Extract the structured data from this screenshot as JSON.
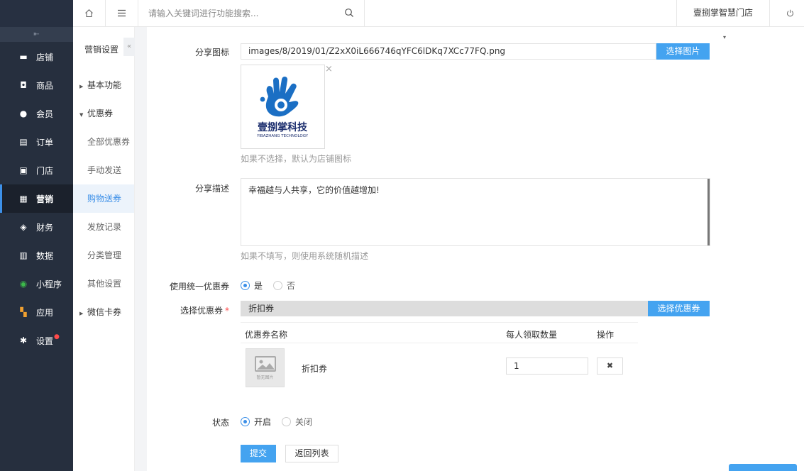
{
  "topbar": {
    "search_placeholder": "请输入关键词进行功能搜索...",
    "store_name": "壹捌掌智慧门店"
  },
  "sidebar": {
    "items": [
      {
        "label": "店铺",
        "icon": "store-icon"
      },
      {
        "label": "商品",
        "icon": "goods-icon"
      },
      {
        "label": "会员",
        "icon": "user-icon"
      },
      {
        "label": "订单",
        "icon": "order-icon"
      },
      {
        "label": "门店",
        "icon": "shop-icon"
      },
      {
        "label": "营销",
        "icon": "gift-icon"
      },
      {
        "label": "财务",
        "icon": "money-icon"
      },
      {
        "label": "数据",
        "icon": "chart-icon"
      },
      {
        "label": "小程序",
        "icon": "miniprogram-icon"
      },
      {
        "label": "应用",
        "icon": "apps-icon"
      },
      {
        "label": "设置",
        "icon": "gear-icon"
      }
    ],
    "active_color": "#3d90e8"
  },
  "subnav": {
    "title": "营销设置",
    "items": [
      {
        "label": "基本功能"
      },
      {
        "label": "优惠券"
      },
      {
        "label": "全部优惠券"
      },
      {
        "label": "手动发送"
      },
      {
        "label": "购物送券"
      },
      {
        "label": "发放记录"
      },
      {
        "label": "分类管理"
      },
      {
        "label": "其他设置"
      },
      {
        "label": "微信卡券"
      }
    ]
  },
  "form": {
    "share_icon": {
      "label": "分享图标",
      "value": "images/8/2019/01/Z2xX0iL666746qYFC6lDKq7XCc77FQ.png",
      "button": "选择图片",
      "hint": "如果不选择，默认为店铺图标",
      "logo_title": "壹捌掌科技",
      "logo_subtitle": "YIBAZHANG TECHNOLOGY"
    },
    "share_desc": {
      "label": "分享描述",
      "value": "幸福越与人共享，它的价值越增加!",
      "hint": "如果不填写，则使用系统随机描述"
    },
    "unified_coupon": {
      "label": "使用统一优惠券",
      "option_yes": "是",
      "option_no": "否",
      "selected": "是"
    },
    "select_coupon": {
      "label": "选择优惠券",
      "value": "折扣券",
      "button": "选择优惠券",
      "columns": {
        "name": "优惠券名称",
        "qty": "每人领取数量",
        "action": "操作"
      },
      "rows": [
        {
          "thumb_caption": "暂无图片",
          "name": "折扣券",
          "qty": "1"
        }
      ]
    },
    "status": {
      "label": "状态",
      "option_on": "开启",
      "option_off": "关闭",
      "selected": "开启"
    },
    "submit": "提交",
    "back": "返回列表"
  },
  "colors": {
    "primary": "#44a3f0",
    "sidebar_bg": "#262f3e",
    "required": "#ff4a4a"
  }
}
